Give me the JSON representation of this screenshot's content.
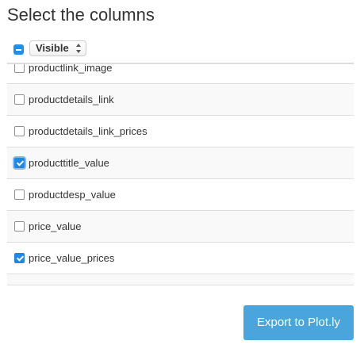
{
  "dialog": {
    "title": "Select the columns",
    "filter_select": {
      "value": "Visible",
      "master_checkbox_state": "indeterminate"
    },
    "columns": [
      {
        "label": "productlink_image",
        "checked": false,
        "focused": false,
        "striped": false
      },
      {
        "label": "productdetails_link",
        "checked": false,
        "focused": false,
        "striped": true
      },
      {
        "label": "productdetails_link_prices",
        "checked": false,
        "focused": false,
        "striped": false
      },
      {
        "label": "producttitle_value",
        "checked": true,
        "focused": true,
        "striped": true
      },
      {
        "label": "productdesp_value",
        "checked": false,
        "focused": false,
        "striped": false
      },
      {
        "label": "price_value",
        "checked": false,
        "focused": false,
        "striped": true
      },
      {
        "label": "price_value_prices",
        "checked": true,
        "focused": false,
        "striped": false
      },
      {
        "label": "",
        "checked": false,
        "focused": false,
        "striped": true
      }
    ],
    "export_button_label": "Export to Plot.ly"
  },
  "colors": {
    "accent": "#1e88e5",
    "button": "#4aa5dd",
    "stripe": "#f9f9f9",
    "divider": "#dddddd"
  }
}
